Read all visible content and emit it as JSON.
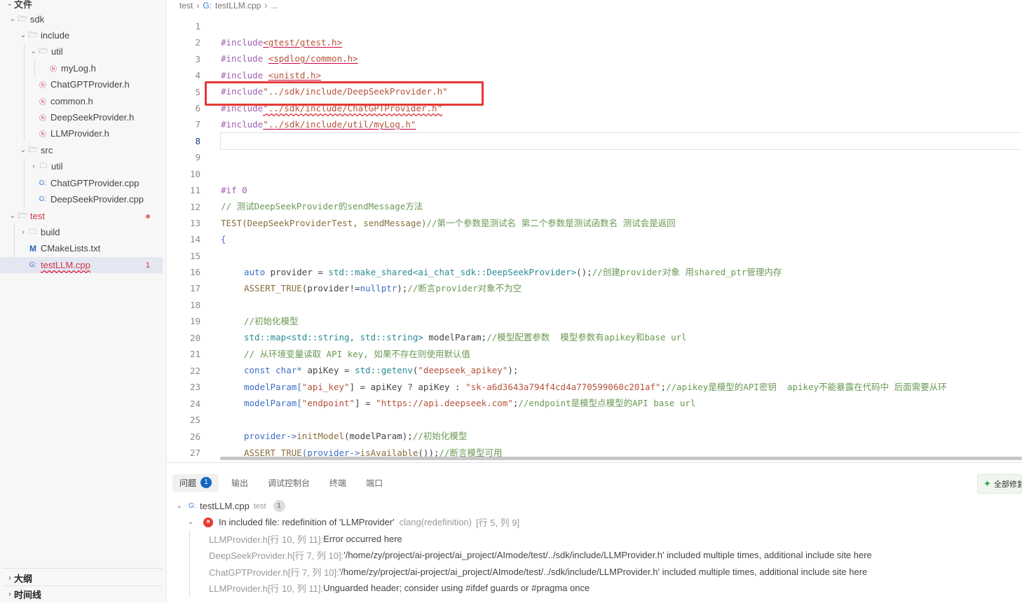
{
  "sidebar": {
    "header_label": "文件",
    "tree": {
      "sdk": "sdk",
      "include": "include",
      "util_inc": "util",
      "mylog_h": "myLog.h",
      "chatgptprovider_h": "ChatGPTProvider.h",
      "common_h": "common.h",
      "deepseekprovider_h": "DeepSeekProvider.h",
      "llmprovider_h": "LLMProvider.h",
      "src": "src",
      "util_src": "util",
      "chatgptprovider_cpp": "ChatGPTProvider.cpp",
      "deepseekprovider_cpp": "DeepSeekProvider.cpp",
      "test": "test",
      "build": "build",
      "cmakelists": "CMakeLists.txt",
      "testllm_cpp": "testLLM.cpp",
      "testllm_problems": "1"
    },
    "outline_label": "大纲",
    "timeline_label": "时间线"
  },
  "breadcrumb": {
    "folder": "test",
    "file": "testLLM.cpp",
    "more": "..."
  },
  "editor": {
    "line_numbers": [
      "1",
      "2",
      "3",
      "4",
      "5",
      "6",
      "7",
      "8",
      "9",
      "10",
      "11",
      "12",
      "13",
      "14",
      "15",
      "16",
      "17",
      "18",
      "19",
      "20",
      "21",
      "22",
      "23",
      "24",
      "25",
      "26",
      "27"
    ],
    "lines": {
      "l1_dir": "#include",
      "l1_path": "<gtest/gtest.h>",
      "l2_dir": "#include ",
      "l2_path": "<spdlog/common.h>",
      "l3_dir": "#include ",
      "l3_path": "<unistd.h>",
      "l4_dir": "#include",
      "l4_path": "\"../sdk/include/DeepSeekProvider.h\"",
      "l5_dir": "#include",
      "l5_path": "\"../sdk/include/ChatGPTProvider.h\"",
      "l6_dir": "#include",
      "l6_path": "\"../sdk/include/util/myLog.h\"",
      "l10": "#if 0",
      "l11": "// 测试DeepSeekProvider的sendMessage方法",
      "l12_code": "TEST(DeepSeekProviderTest, sendMessage)",
      "l12_cm": "//第一个参数是测试名 第二个参数是测试函数名 测试会是返回",
      "l13": "{",
      "l15_kw": "auto",
      "l15_tx": " provider = ",
      "l15_ty": "std::make_shared<ai_chat_sdk::DeepSeekProvider>",
      "l15_tx2": "();",
      "l15_cm": "//创建provider对象 用shared_ptr管理内存",
      "l16_fn": "ASSERT_TRUE",
      "l16_tx": "(provider!=",
      "l16_kw": "nullptr",
      "l16_tx2": ");",
      "l16_cm": "//断言provider对象不为空",
      "l18": "//初始化模型",
      "l19_ty": "std::map<std::string, std::string>",
      "l19_tx": " modelParam;",
      "l19_cm": "//模型配置参数  模型参数有apikey和base url",
      "l20": "// 从环境变量读取 API key, 如果不存在则使用默认值",
      "l21_kw": "const char*",
      "l21_tx": " apiKey = ",
      "l21_ty": "std::getenv",
      "l21_tx2": "(",
      "l21_str": "\"deepseek_apikey\"",
      "l21_tx3": ");",
      "l22_a": "modelParam[",
      "l22_str": "\"api_key\"",
      "l22_b": "] = apiKey ? apiKey : ",
      "l22_str2": "\"sk-a6d3643a794f4cd4a770599060c201af\"",
      "l22_c": ";",
      "l22_cm": "//apikey是模型的API密钥  apikey不能暴露在代码中 后面需要从环",
      "l23_a": "modelParam[",
      "l23_str": "\"endpoint\"",
      "l23_b": "] = ",
      "l23_str2": "\"https://api.deepseek.com\"",
      "l23_c": ";",
      "l23_cm": "//endpoint是模型点模型的API base url",
      "l25_a": "provider->",
      "l25_fn": "initModel",
      "l25_b": "(modelParam);",
      "l25_cm": "//初始化模型",
      "l26_fn": "ASSERT_TRUE",
      "l26_a": "(provider->",
      "l26_fn2": "isAvailable",
      "l26_b": "());",
      "l26_cm": "//断言模型可用"
    }
  },
  "panel": {
    "tabs": [
      "问题",
      "输出",
      "调试控制台",
      "终端",
      "端口"
    ],
    "problem_count": "1",
    "ai_button": "全部修复",
    "file_row": {
      "file": "testLLM.cpp",
      "folder": "test",
      "count": "1"
    },
    "error": {
      "message": "In included file: redefinition of 'LLMProvider'",
      "source": "clang(redefinition)",
      "location": "[行 5, 列 9]"
    },
    "details": [
      {
        "file": "LLMProvider.h[行 10, 列 11]:",
        "text": " Error occurred here"
      },
      {
        "file": "DeepSeekProvider.h[行 7, 列 10]:",
        "text": " '/home/zy/project/ai-project/ai_project/AImode/test/../sdk/include/LLMProvider.h' included multiple times, additional include site here"
      },
      {
        "file": "ChatGPTProvider.h[行 7, 列 10]:",
        "text": " '/home/zy/project/ai-project/ai_project/AImode/test/../sdk/include/LLMProvider.h' included multiple times, additional include site here"
      },
      {
        "file": "LLMProvider.h[行 10, 列 11]:",
        "text": " Unguarded header; consider using #ifdef guards or #pragma once"
      }
    ]
  },
  "colors": {
    "accent_blue": "#1565c0",
    "error_red": "#e53935",
    "highlight_box": "#e53935",
    "selected_row": "#e4e6f1"
  }
}
